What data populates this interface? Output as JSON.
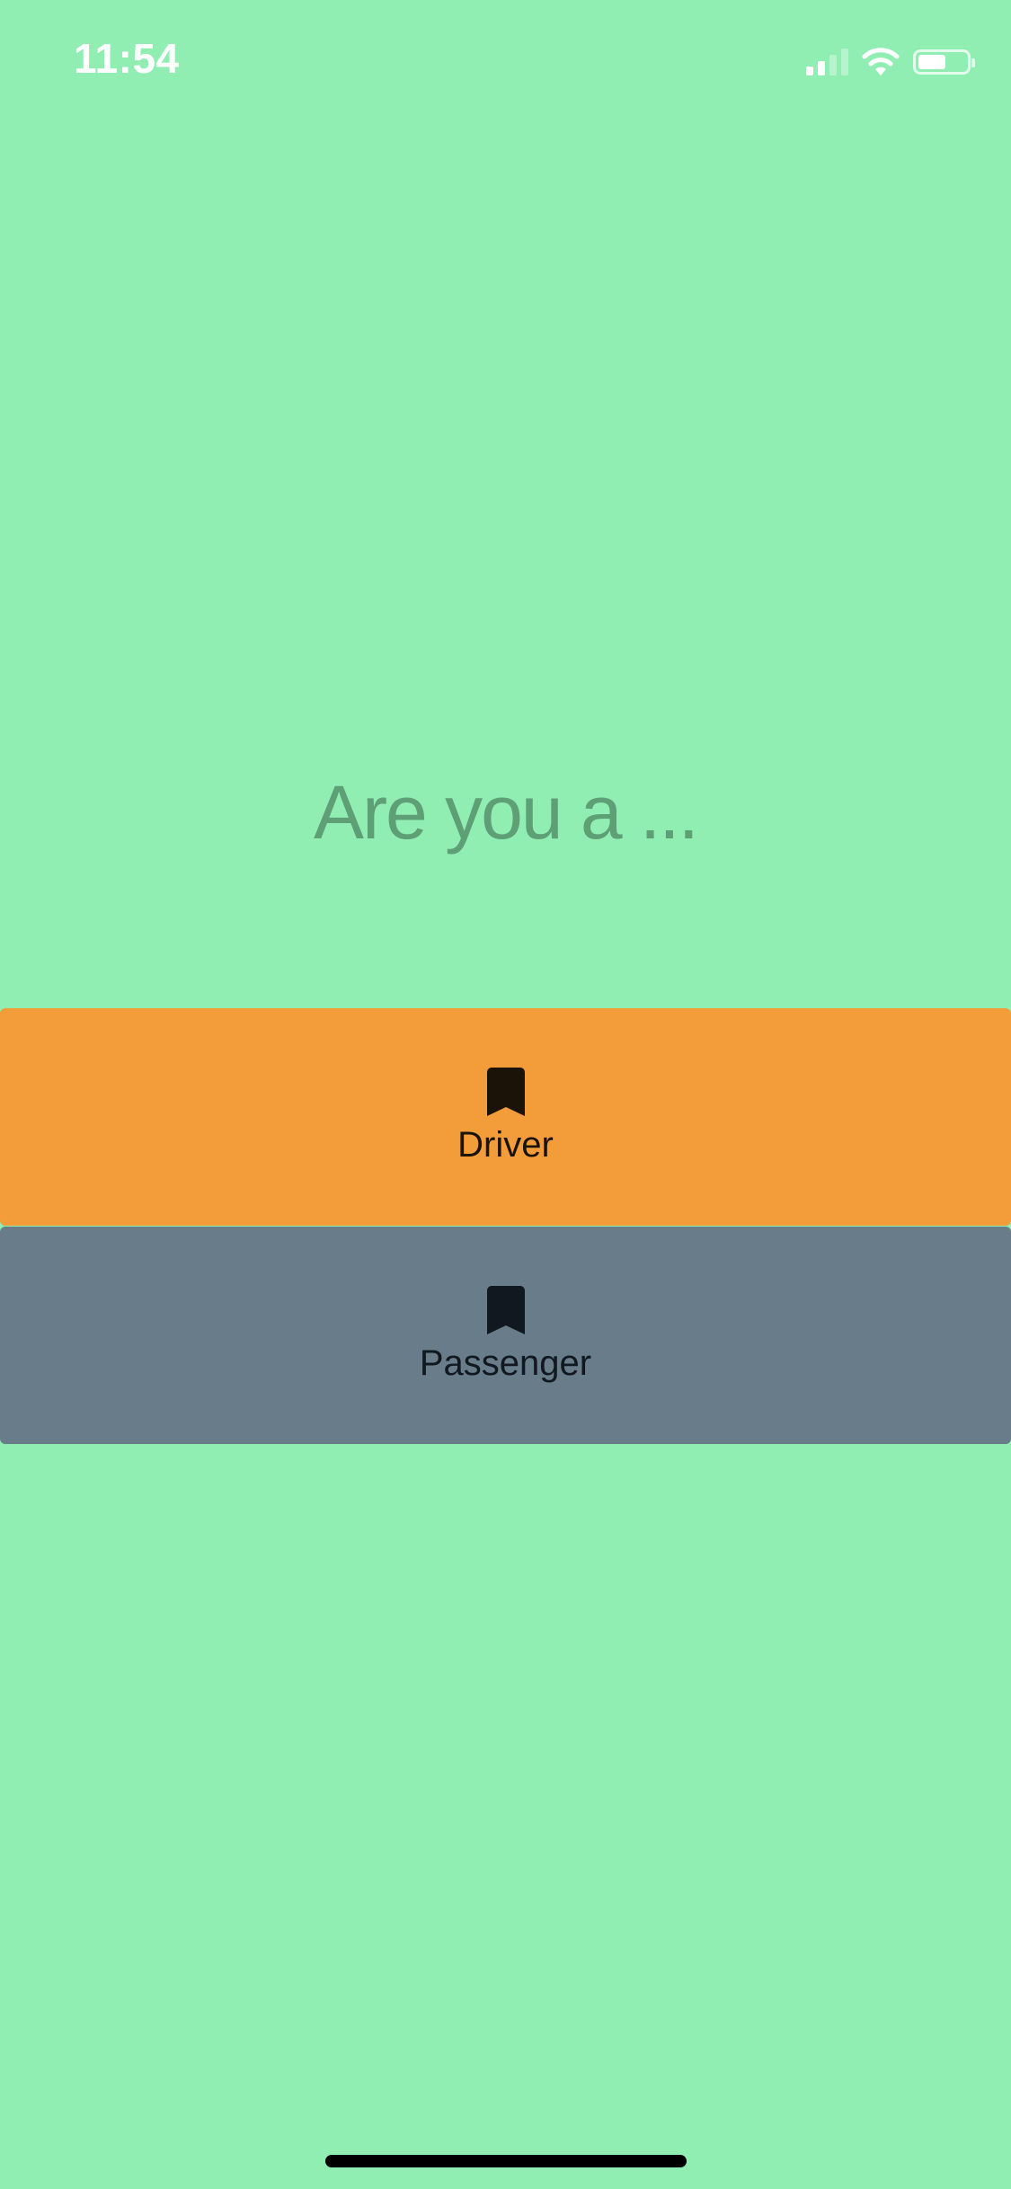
{
  "status_bar": {
    "time": "11:54",
    "signal_icon": "cellular-signal-icon",
    "signal_bars_active": 2,
    "signal_bars_total": 4,
    "wifi_icon": "wifi-icon",
    "battery_icon": "battery-icon",
    "battery_level": 0.58
  },
  "prompt": {
    "question": "Are you a ..."
  },
  "roles": [
    {
      "label": "Driver",
      "icon": "bookmark-icon",
      "background": "#f29d3a"
    },
    {
      "label": "Passenger",
      "icon": "bookmark-icon",
      "background": "#687d89"
    }
  ],
  "colors": {
    "background": "#90eeb3",
    "question_text": "#5f9f76",
    "driver": "#f29d3a",
    "passenger": "#687d89"
  }
}
